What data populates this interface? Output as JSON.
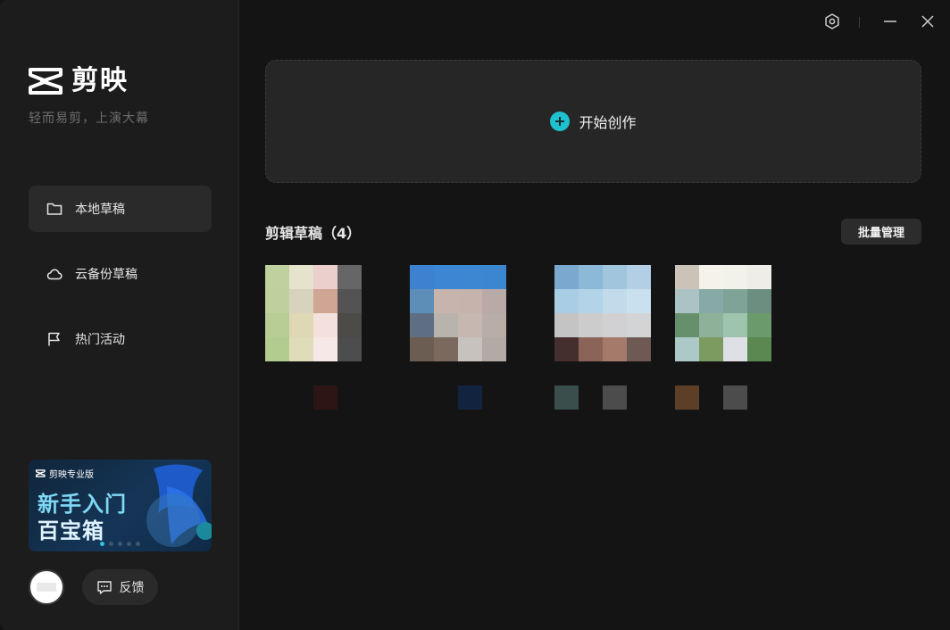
{
  "app": {
    "logo_text": "剪映",
    "slogan": "轻而易剪，上演大幕"
  },
  "sidebar": {
    "items": [
      {
        "label": "本地草稿",
        "icon": "folder-icon",
        "active": true
      },
      {
        "label": "云备份草稿",
        "icon": "cloud-icon",
        "active": false
      },
      {
        "label": "热门活动",
        "icon": "flag-icon",
        "active": false
      }
    ],
    "banner": {
      "brand": "剪映专业版",
      "line1": "新手入门",
      "line2": "百宝箱",
      "dot_count": 5,
      "active_dot": 0
    },
    "feedback_label": "反馈"
  },
  "titlebar": {
    "icons": [
      "settings-icon",
      "minimize-icon",
      "close-icon"
    ]
  },
  "main": {
    "create_label": "开始创作",
    "drafts_title": "剪辑草稿（4）",
    "batch_label": "批量管理",
    "drafts": [
      {
        "colors": [
          "#c0d1a0",
          "#e6e3cc",
          "#ebcfcc",
          "#666666",
          "#bfcf9d",
          "#d7d3bf",
          "#cfa593",
          "#545252",
          "#b7cd95",
          "#dfd8b5",
          "#f4e1de",
          "#4d4b48",
          "#b2cb8e",
          "#dfdcba",
          "#f5e8e6",
          "#4d4d4d"
        ],
        "meta": [
          null,
          "#2d1515"
        ]
      },
      {
        "colors": [
          "#3c82d1",
          "#3d86d3",
          "#3d87d2",
          "#3c86d0",
          "#5c8eb8",
          "#c7b5ad",
          "#c6b3ac",
          "#b9aaa7",
          "#5e6f83",
          "#b9b3ae",
          "#c6b8b0",
          "#b9ada8",
          "#6b5d51",
          "#7a695c",
          "#c7c2bd",
          "#b3aaa5"
        ],
        "meta": [
          null,
          "#122340"
        ]
      },
      {
        "colors": [
          "#7aa8cf",
          "#8cb9d8",
          "#a2c5de",
          "#b2cfe5",
          "#a9cde5",
          "#b3d3e8",
          "#c1dbea",
          "#c9e1ef",
          "#c4c4c4",
          "#cdcccc",
          "#d1d1d3",
          "#d3d4d6",
          "#442e2e",
          "#8c6358",
          "#a67a6a",
          "#6e5a52"
        ],
        "meta": [
          "#3a4f4c",
          "#4c4c4c"
        ]
      },
      {
        "colors": [
          "#cbc2b8",
          "#f4f2ea",
          "#f2f1ea",
          "#eeede8",
          "#abc3c5",
          "#88aaa6",
          "#7fa397",
          "#6c8e81",
          "#66906c",
          "#8eb299",
          "#9fc4ad",
          "#6b9b6d",
          "#acc9c7",
          "#7c9b60",
          "#dfe0e6",
          "#5a8850"
        ],
        "meta": [
          "#5d3f28",
          "#4c4c4c"
        ]
      }
    ]
  },
  "colors": {
    "accent": "#1fc1cf",
    "sidebar_bg": "#1c1c1c",
    "main_bg": "#141414",
    "card_bg": "#262626"
  }
}
